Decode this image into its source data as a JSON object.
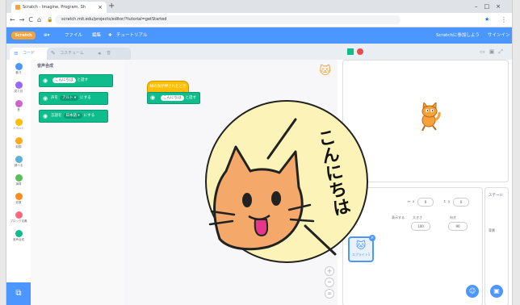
{
  "browser": {
    "tab_title": "Scratch - Imagine, Program, Sh",
    "tab_close": "×",
    "new_tab": "+",
    "window_controls": "–□×",
    "nav": "←→C⌂",
    "url": "scratch.mit.edu/projects/editor/?tutorial=getStarted"
  },
  "menubar": {
    "logo": "Scratch",
    "items": [
      "ファイル",
      "編集",
      "チュートリアル"
    ],
    "right": [
      "Scratchに参加しよう",
      "サインイン"
    ]
  },
  "code_tabs": [
    "コード",
    "コスチューム",
    "音"
  ],
  "categories": [
    {
      "label": "動き",
      "color": "#4c97ff"
    },
    {
      "label": "見た目",
      "color": "#9966ff"
    },
    {
      "label": "音",
      "color": "#cf63cf"
    },
    {
      "label": "イベント",
      "color": "#ffbf00"
    },
    {
      "label": "制御",
      "color": "#ffab19"
    },
    {
      "label": "調べる",
      "color": "#5cb1d6"
    },
    {
      "label": "演算",
      "color": "#59c059"
    },
    {
      "label": "変数",
      "color": "#ff8c1a"
    },
    {
      "label": "ブロック定義",
      "color": "#ff6680"
    },
    {
      "label": "音声合成",
      "color": "#0fbd8c"
    }
  ],
  "palette": {
    "heading": "音声合成",
    "blocks": [
      {
        "prefix": "",
        "pill": "こんにちは",
        "suffix": "と話す"
      },
      {
        "prefix": "声を",
        "pill": "アルト ▾",
        "suffix": "にする"
      },
      {
        "prefix": "言語を",
        "pill": "日本語 ▾",
        "suffix": "にする"
      }
    ]
  },
  "workspace": {
    "hat_label": "緑の旗が押されたとき",
    "block_pill": "こんにちは",
    "block_suffix": "と話す",
    "zoom": [
      "+",
      "−",
      "="
    ]
  },
  "sprite_info": {
    "x_label": "x",
    "x_value": "0",
    "y_label": "y",
    "y_value": "0",
    "show_label": "表示する",
    "size_label": "大きさ",
    "size_value": "100",
    "direction_label": "向き",
    "direction_value": "90",
    "sprite_name": "スプライト1"
  },
  "stage_panel": {
    "label": "ステージ",
    "backdrops_label": "背景"
  },
  "illustration": {
    "speech": "こんにちは"
  }
}
